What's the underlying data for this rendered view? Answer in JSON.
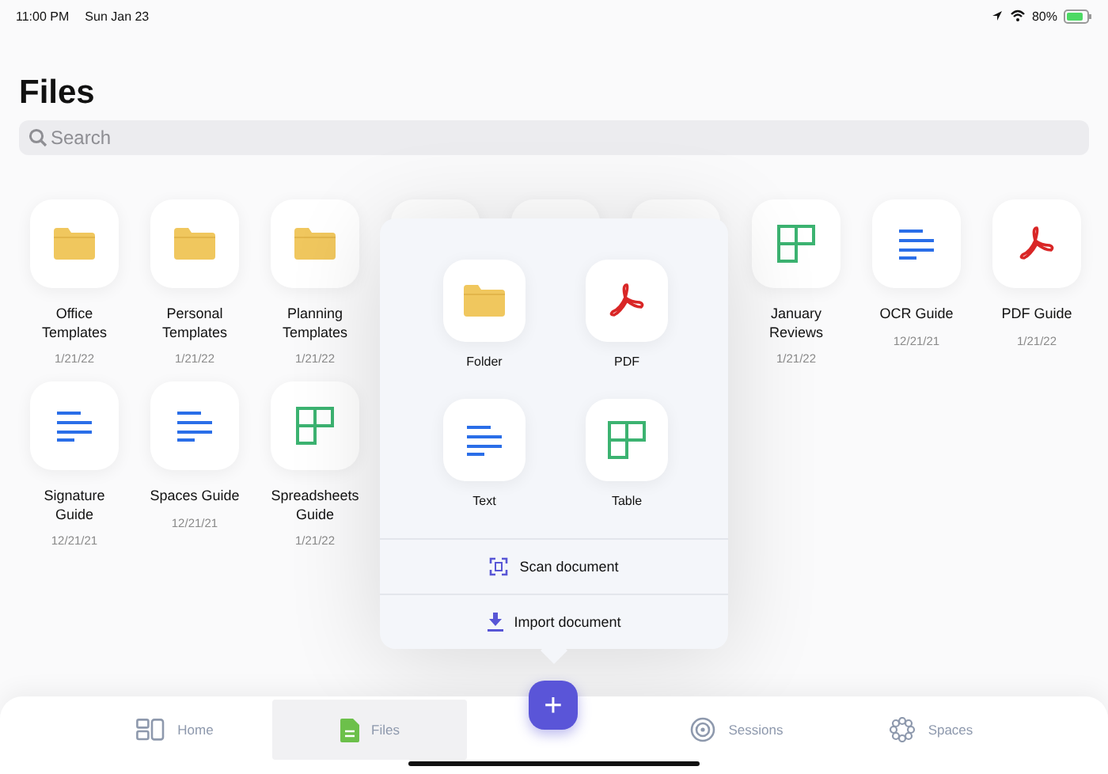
{
  "status_bar": {
    "time": "11:00 PM",
    "date": "Sun Jan 23",
    "battery": "80%"
  },
  "title": "Files",
  "search": {
    "placeholder": "Search"
  },
  "rows": [
    [
      {
        "kind": "folder",
        "name": "Office Templates",
        "date": "1/21/22"
      },
      {
        "kind": "folder",
        "name": "Personal Templates",
        "date": "1/21/22"
      },
      {
        "kind": "folder",
        "name": "Planning Templates",
        "date": "1/21/22"
      },
      {
        "kind": "covered"
      },
      {
        "kind": "covered"
      },
      {
        "kind": "covered"
      },
      {
        "kind": "table",
        "name": "January Reviews",
        "date": "1/21/22"
      },
      {
        "kind": "text",
        "name": "OCR Guide",
        "date": "12/21/21"
      },
      {
        "kind": "pdf",
        "name": "PDF Guide",
        "date": "1/21/22"
      }
    ],
    [
      {
        "kind": "text",
        "name": "Signature Guide",
        "date": "12/21/21"
      },
      {
        "kind": "text",
        "name": "Spaces Guide",
        "date": "12/21/21"
      },
      {
        "kind": "table",
        "name": "Spreadsheets Guide",
        "date": "1/21/22"
      }
    ]
  ],
  "popover": {
    "options": [
      {
        "kind": "folder",
        "label": "Folder"
      },
      {
        "kind": "pdf",
        "label": "PDF"
      },
      {
        "kind": "text",
        "label": "Text"
      },
      {
        "kind": "table",
        "label": "Table"
      }
    ],
    "actions": [
      {
        "kind": "scan",
        "label": "Scan document"
      },
      {
        "kind": "import",
        "label": "Import document"
      }
    ]
  },
  "tabs": [
    {
      "kind": "home",
      "label": "Home",
      "selected": false
    },
    {
      "kind": "files",
      "label": "Files",
      "selected": true
    },
    {
      "kind": "add",
      "label": "+"
    },
    {
      "kind": "sessions",
      "label": "Sessions",
      "selected": false
    },
    {
      "kind": "spaces",
      "label": "Spaces",
      "selected": false
    }
  ]
}
